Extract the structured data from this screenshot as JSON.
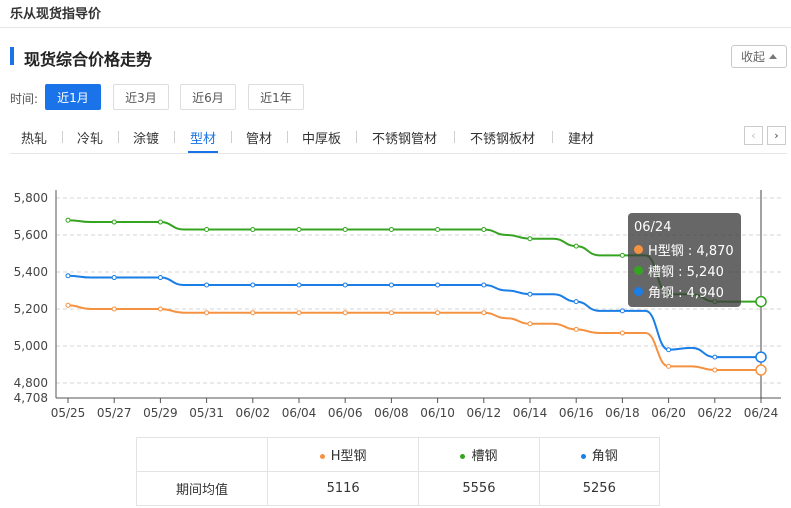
{
  "app": {
    "title": "乐从现货指导价"
  },
  "section": {
    "title": "现货综合价格走势",
    "collapse_label": "收起"
  },
  "time_filter": {
    "label": "时间:",
    "options": [
      "近1月",
      "近3月",
      "近6月",
      "近1年"
    ],
    "selected": "近1月"
  },
  "tabs": {
    "items": [
      "热轧",
      "冷轧",
      "涂镀",
      "型材",
      "管材",
      "中厚板",
      "不锈钢管材",
      "不锈钢板材",
      "建材"
    ],
    "active": "型材",
    "prev_label": "‹",
    "next_label": "›"
  },
  "colors": {
    "accent": "#1a73e8",
    "h_steel": "#f59242",
    "channel_steel": "#35a421",
    "angle_steel": "#1a7ee6"
  },
  "chart_data": {
    "type": "line",
    "x": [
      "05/25",
      "05/26",
      "05/27",
      "05/28",
      "05/29",
      "05/30",
      "05/31",
      "06/01",
      "06/02",
      "06/03",
      "06/04",
      "06/05",
      "06/06",
      "06/07",
      "06/08",
      "06/09",
      "06/10",
      "06/11",
      "06/12",
      "06/13",
      "06/14",
      "06/15",
      "06/16",
      "06/17",
      "06/18",
      "06/19",
      "06/20",
      "06/21",
      "06/22",
      "06/23",
      "06/24"
    ],
    "x_tick_labels": [
      "05/25",
      "05/27",
      "05/29",
      "05/31",
      "06/02",
      "06/04",
      "06/06",
      "06/08",
      "06/10",
      "06/12",
      "06/14",
      "06/16",
      "06/18",
      "06/20",
      "06/22",
      "06/24"
    ],
    "y_ticks": [
      4708,
      4800,
      5000,
      5200,
      5400,
      5600,
      5800
    ],
    "y_tick_labels": [
      "4,708",
      "4,800",
      "5,000",
      "5,200",
      "5,400",
      "5,600",
      "5,800"
    ],
    "ylim": [
      4708,
      5800
    ],
    "grid": true,
    "series": [
      {
        "name": "H型钢",
        "values": [
          5220,
          5200,
          5200,
          5200,
          5200,
          5180,
          5180,
          5180,
          5180,
          5180,
          5180,
          5180,
          5180,
          5180,
          5180,
          5180,
          5180,
          5180,
          5180,
          5150,
          5120,
          5120,
          5090,
          5070,
          5070,
          5070,
          4890,
          4890,
          4870,
          4870,
          4870
        ]
      },
      {
        "name": "槽钢",
        "values": [
          5680,
          5670,
          5670,
          5670,
          5670,
          5630,
          5630,
          5630,
          5630,
          5630,
          5630,
          5630,
          5630,
          5630,
          5630,
          5630,
          5630,
          5630,
          5630,
          5600,
          5580,
          5580,
          5540,
          5490,
          5490,
          5490,
          5280,
          5280,
          5240,
          5240,
          5240
        ]
      },
      {
        "name": "角钢",
        "values": [
          5380,
          5370,
          5370,
          5370,
          5370,
          5330,
          5330,
          5330,
          5330,
          5330,
          5330,
          5330,
          5330,
          5330,
          5330,
          5330,
          5330,
          5330,
          5330,
          5300,
          5280,
          5280,
          5240,
          5190,
          5190,
          5190,
          4980,
          4990,
          4940,
          4940,
          4940
        ]
      }
    ],
    "tooltip": {
      "date": "06/24",
      "rows": [
        {
          "label": "H型钢 : 4,870",
          "color": "#f59242"
        },
        {
          "label": "槽钢 : 5,240",
          "color": "#35a421"
        },
        {
          "label": "角钢 : 4,940",
          "color": "#1a7ee6"
        }
      ]
    }
  },
  "summary_table": {
    "row_label": "期间均值",
    "columns": [
      {
        "name": "H型钢",
        "color": "#f59242",
        "value": "5116"
      },
      {
        "name": "槽钢",
        "color": "#35a421",
        "value": "5556"
      },
      {
        "name": "角钢",
        "color": "#1a7ee6",
        "value": "5256"
      }
    ]
  }
}
